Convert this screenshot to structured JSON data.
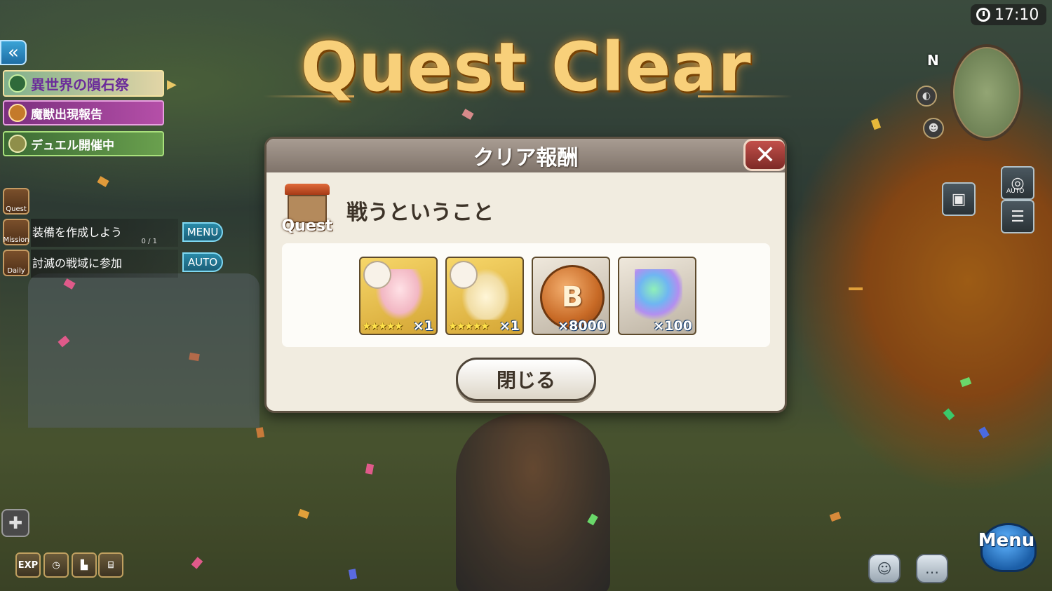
{
  "screen": {
    "clock": "17:10",
    "title": "Quest Clear"
  },
  "left_panel": {
    "back_icon": "double-chevron-left-icon",
    "banners": [
      {
        "label": "異世界の隕石祭",
        "icon": "green-shield-icon"
      },
      {
        "label": "魔獣出現報告",
        "icon": "beast-face-icon"
      },
      {
        "label": "デュエル開催中",
        "icon": "crossed-swords-icon"
      }
    ],
    "quest_icon_label": "Quest",
    "mission": {
      "icon_label": "Mission",
      "text": "装備を作成しよう",
      "progress": "0 / 1",
      "button": "MENU"
    },
    "daily": {
      "icon_label": "Daily",
      "text": "討滅の戦域に参加",
      "button": "AUTO"
    }
  },
  "minimap": {
    "north": "N"
  },
  "right_buttons": {
    "auto_label": "AUTO"
  },
  "modal": {
    "header": "クリア報酬",
    "quest_badge": "Quest",
    "quest_name": "戦うということ",
    "rewards": [
      {
        "item": "scarf",
        "stars": "★★★★★",
        "qty": "×1",
        "rarity_color": "#e6b73e"
      },
      {
        "item": "socks",
        "stars": "★★★★★",
        "qty": "×1",
        "rarity_color": "#e6b73e"
      },
      {
        "item": "coin",
        "stars": "",
        "qty": "×8000",
        "coin_letter": "B"
      },
      {
        "item": "crystal",
        "stars": "",
        "qty": "×100"
      }
    ],
    "close_button": "閉じる"
  },
  "bottom_left": {
    "exp_label": "EXP"
  },
  "bottom_right": {
    "menu_label": "Menu"
  }
}
